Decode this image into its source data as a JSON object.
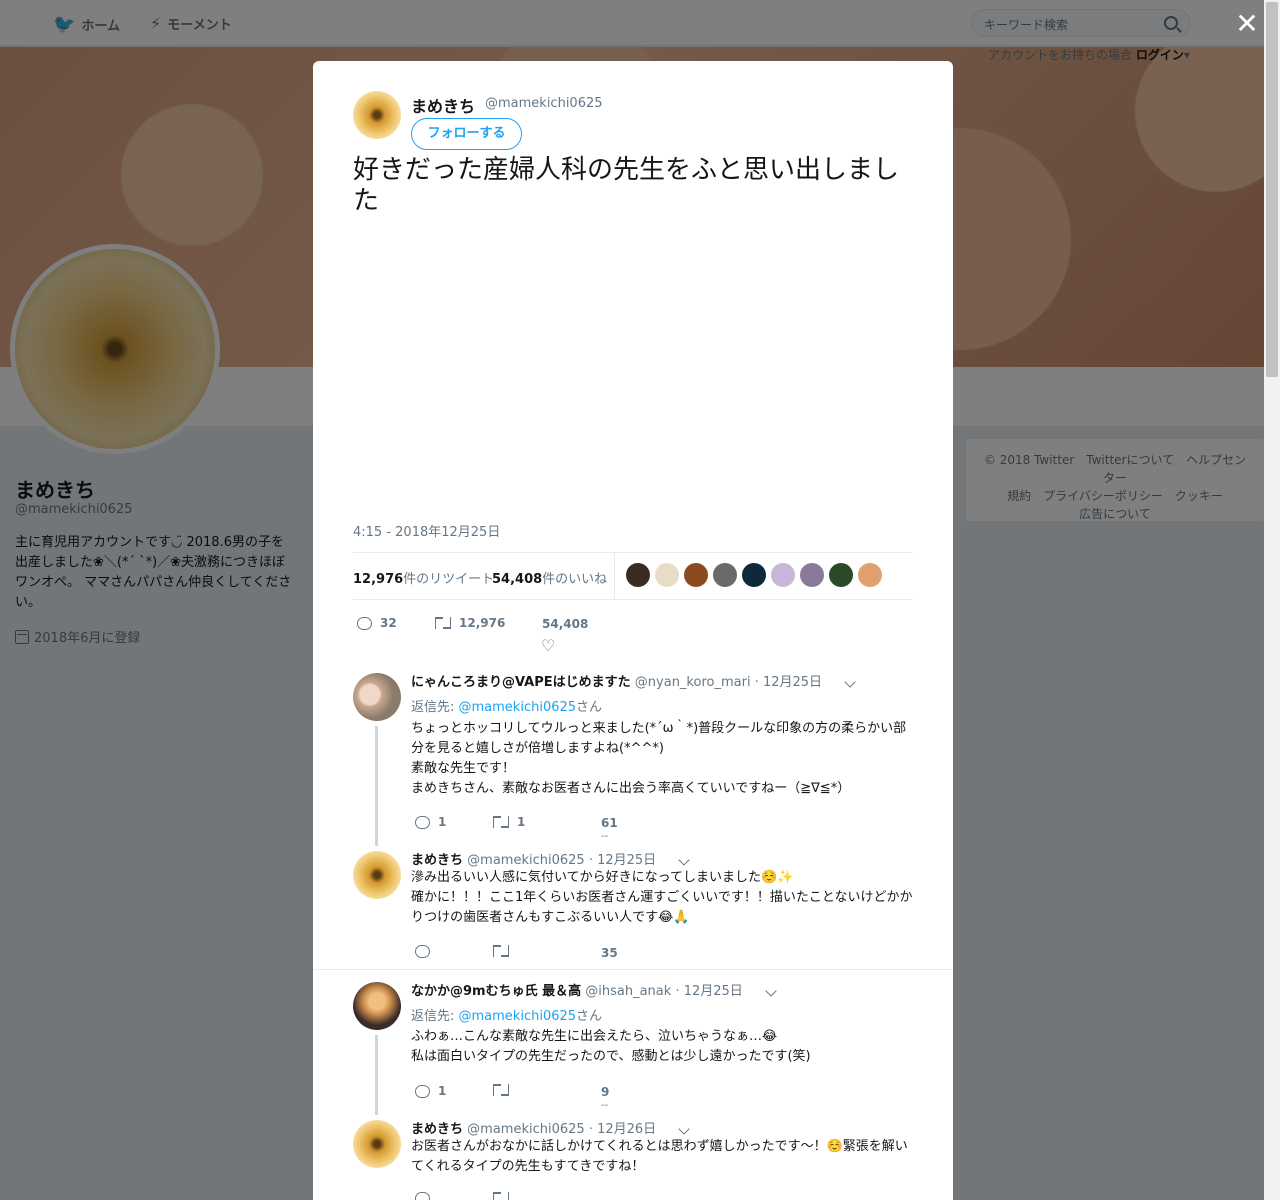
{
  "nav": {
    "home": "ホーム",
    "moments": "モーメント",
    "search_placeholder": "キーワード検索",
    "login_prefix": "アカウントをお持ちの場合",
    "login": "ログイン"
  },
  "profile": {
    "name": "まめきち",
    "handle": "@mamekichi0625",
    "bio": "主に育児用アカウントです◡̈ 2018.6男の子を出産しました❀＼(*´ `*)／❀夫激務につきほぼワンオペ。 ママさんパパさん仲良くしてください。",
    "joined": "2018年6月に登録"
  },
  "footer": {
    "line1": "© 2018 Twitter　Twitterについて　ヘルプセンター",
    "line2": "規約　プライバシーポリシー　クッキー",
    "line3": "広告について"
  },
  "tweet": {
    "name": "まめきち",
    "handle": "@mamekichi0625",
    "follow": "フォローする",
    "text": "好きだった産婦人科の先生をふと思い出しました",
    "time": "4:15 - 2018年12月25日",
    "retweets": "12,976",
    "retweets_label": "件のリツイート",
    "likes": "54,408",
    "likes_label": "件のいいね",
    "reply_count": "32",
    "rt_count": "12,976",
    "like_count": "54,408"
  },
  "replies": [
    {
      "name": "にゃんころまり@VAPEはじめますた",
      "handle": "@nyan_koro_mari",
      "date": "· 12月25日",
      "reply_to_label": "返信先: ",
      "reply_to": "@mamekichi0625",
      "reply_to_suffix": "さん",
      "lines": [
        "ちょっとホッコリしてウルっと来ました(*´ω｀*)普段クールな印象の方の柔らかい部分を見ると嬉しさが倍増しますよね(*^^*)",
        "素敵な先生です！",
        "まめきちさん、素敵なお医者さんに出会う率高くていいですねー（≧∇≦*）"
      ],
      "reply": "1",
      "rt": "1",
      "like": "61"
    },
    {
      "name": "まめきち",
      "handle": "@mamekichi0625",
      "date": "· 12月25日",
      "lines": [
        "滲み出るいい人感に気付いてから好きになってしまいました☺️✨",
        "確かに！！！ここ1年くらいお医者さん運すごくいいです！！描いたことないけどかかりつけの歯医者さんもすこぶるいい人です😂🙏"
      ],
      "like": "35"
    },
    {
      "name": "なかか@9mむちゅ氏 最＆高",
      "handle": "@ihsah_anak",
      "date": "· 12月25日",
      "reply_to_label": "返信先: ",
      "reply_to": "@mamekichi0625",
      "reply_to_suffix": "さん",
      "lines": [
        "ふわぁ…こんな素敵な先生に出会えたら、泣いちゃうなぁ…😂",
        "私は面白いタイプの先生だったので、感動とは少し遠かったです(笑)"
      ],
      "reply": "1",
      "like": "9"
    },
    {
      "name": "まめきち",
      "handle": "@mamekichi0625",
      "date": "· 12月26日",
      "lines": [
        "お医者さんがおなかに話しかけてくれるとは思わず嬉しかったです〜！☺️緊張を解いてくれるタイプの先生もすてきですね！"
      ]
    }
  ],
  "colors": {
    "accent": "#1da1f2",
    "text": "#14171a",
    "muted": "#657786"
  }
}
